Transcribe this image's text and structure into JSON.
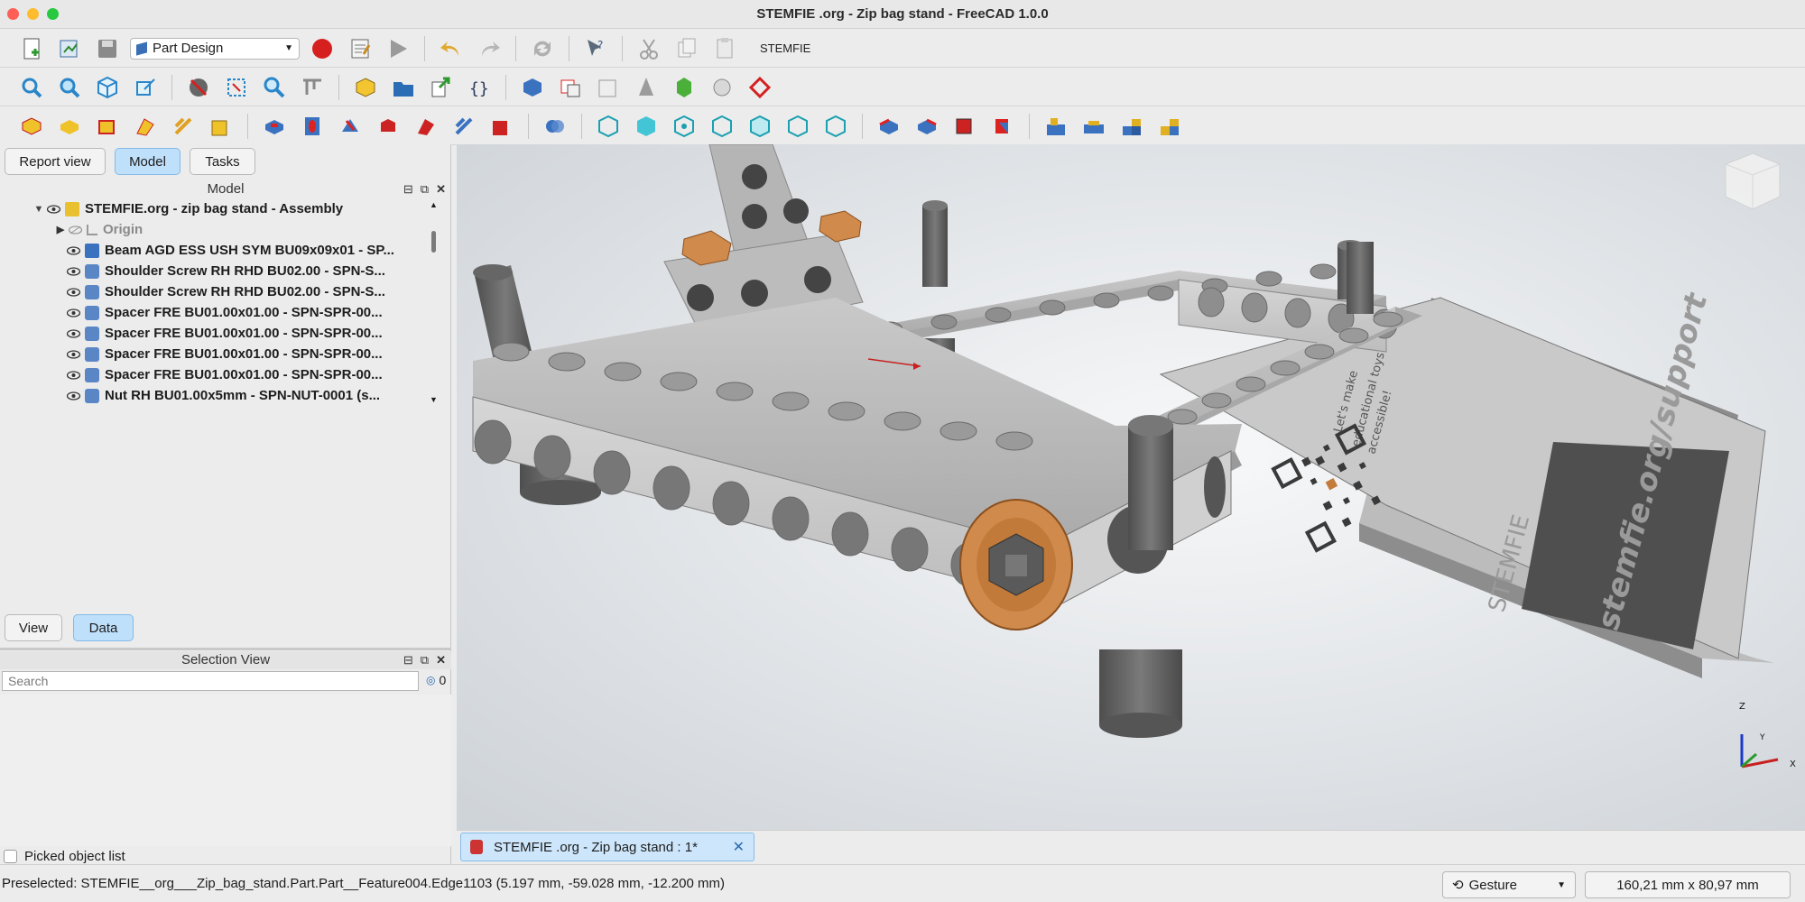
{
  "window": {
    "title": "STEMFIE .org - Zip bag stand - FreeCAD 1.0.0"
  },
  "toolbar1": {
    "icons": [
      "new-file-icon",
      "open-file-icon",
      "save-icon"
    ],
    "workbench": "Part Design",
    "icons2": [
      "record-macro-icon",
      "macro-editor-icon",
      "run-macro-icon",
      "undo-icon",
      "redo-icon",
      "refresh-icon",
      "whats-this-icon",
      "cut-icon",
      "copy-icon",
      "paste-icon"
    ],
    "label": "STEMFIE"
  },
  "tree_panel": {
    "tabs": [
      "Report view",
      "Model",
      "Tasks"
    ],
    "active_tab": "Model",
    "title": "Model",
    "root": "STEMFIE.org - zip bag stand - Assembly",
    "origin": "Origin",
    "items": [
      "Beam AGD ESS USH SYM BU09x09x01 - SP...",
      "Shoulder Screw RH RHD BU02.00 - SPN-S...",
      "Shoulder Screw RH RHD BU02.00 - SPN-S...",
      "Spacer FRE BU01.00x01.00 - SPN-SPR-00...",
      "Spacer FRE BU01.00x01.00 - SPN-SPR-00...",
      "Spacer FRE BU01.00x01.00 - SPN-SPR-00...",
      "Spacer FRE BU01.00x01.00 - SPN-SPR-00...",
      "Nut RH BU01.00x5mm - SPN-NUT-0001 (s..."
    ],
    "property_tabs": [
      "View",
      "Data"
    ],
    "active_property_tab": "Data"
  },
  "selection_view": {
    "title": "Selection View",
    "search_placeholder": "Search",
    "count": "0",
    "picked_label": "Picked object list"
  },
  "viewport": {
    "plate_text_1": "Let's make",
    "plate_text_2": "educational toys",
    "plate_text_3": "accessible!",
    "plate_url": "stemfie.org/support",
    "plate_brand": "STEMFIE",
    "axis_x": "X",
    "axis_y": "Y",
    "axis_z": "Z"
  },
  "document_tab": {
    "label": "STEMFIE .org - Zip bag stand : 1*"
  },
  "statusbar": {
    "preselected": "Preselected: STEMFIE__org___Zip_bag_stand.Part.Part__Feature004.Edge1103 (5.197 mm, -59.028 mm, -12.200 mm)",
    "nav_style": "Gesture",
    "dimensions": "160,21 mm x 80,97 mm"
  },
  "colors": {
    "accent": "#bfe0fb",
    "selected_tab": "#cde6fb",
    "part_gray": "#a9a9a9",
    "spacer_orange": "#d08a4b"
  }
}
